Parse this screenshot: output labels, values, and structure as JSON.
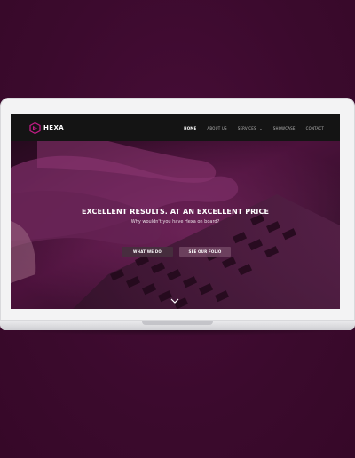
{
  "brand": {
    "name": "HEXA",
    "logo_icon": "hexa-logo-icon",
    "accent": "#c21c86"
  },
  "nav": {
    "items": [
      {
        "label": "HOME",
        "active": true
      },
      {
        "label": "ABOUT US",
        "active": false
      },
      {
        "label": "SERVICES",
        "active": false,
        "dropdown": true
      },
      {
        "label": "SHOWCASE",
        "active": false
      },
      {
        "label": "CONTACT",
        "active": false
      }
    ]
  },
  "hero": {
    "title": "EXCELLENT RESULTS. AT AN EXCELLENT PRICE",
    "subtitle": "Why wouldn't you have Hexa on board?",
    "primary_button": "WHAT WE DO",
    "secondary_button": "SEE OUR FOLIO",
    "scroll_icon": "chevron-down-icon",
    "overlay_color": "#7a1d62"
  },
  "background": {
    "page_color": "#3d0a2f",
    "device": "laptop-mockup"
  }
}
